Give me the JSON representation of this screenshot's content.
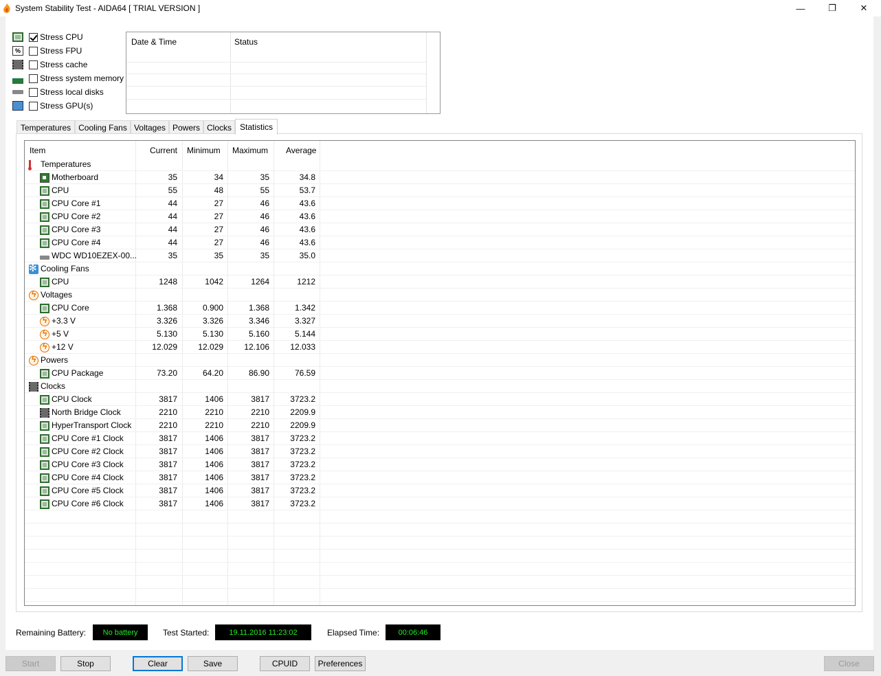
{
  "window": {
    "title": "System Stability Test - AIDA64  [ TRIAL VERSION ]",
    "minimize": "—",
    "maximize": "❐",
    "close": "✕"
  },
  "stress_options": [
    {
      "label": "Stress CPU",
      "checked": true,
      "icon": "cpu-chip-icon"
    },
    {
      "label": "Stress FPU",
      "checked": false,
      "icon": "fpu-icon"
    },
    {
      "label": "Stress cache",
      "checked": false,
      "icon": "cache-icon"
    },
    {
      "label": "Stress system memory",
      "checked": false,
      "icon": "memory-icon"
    },
    {
      "label": "Stress local disks",
      "checked": false,
      "icon": "disk-icon"
    },
    {
      "label": "Stress GPU(s)",
      "checked": false,
      "icon": "gpu-icon"
    }
  ],
  "log": {
    "col_datetime": "Date & Time",
    "col_status": "Status"
  },
  "tabs": [
    {
      "label": "Temperatures",
      "active": false
    },
    {
      "label": "Cooling Fans",
      "active": false
    },
    {
      "label": "Voltages",
      "active": false
    },
    {
      "label": "Powers",
      "active": false
    },
    {
      "label": "Clocks",
      "active": false
    },
    {
      "label": "Statistics",
      "active": true
    }
  ],
  "stats": {
    "headers": {
      "item": "Item",
      "current": "Current",
      "minimum": "Minimum",
      "maximum": "Maximum",
      "average": "Average"
    },
    "rows": [
      {
        "group": true,
        "name": "Temperatures",
        "icon": "thermometer-icon"
      },
      {
        "name": "Motherboard",
        "icon": "motherboard-icon",
        "cur": "35",
        "min": "34",
        "max": "35",
        "avg": "34.8"
      },
      {
        "name": "CPU",
        "icon": "cpu-chip-icon",
        "cur": "55",
        "min": "48",
        "max": "55",
        "avg": "53.7"
      },
      {
        "name": "CPU Core #1",
        "icon": "cpu-chip-icon",
        "cur": "44",
        "min": "27",
        "max": "46",
        "avg": "43.6"
      },
      {
        "name": "CPU Core #2",
        "icon": "cpu-chip-icon",
        "cur": "44",
        "min": "27",
        "max": "46",
        "avg": "43.6"
      },
      {
        "name": "CPU Core #3",
        "icon": "cpu-chip-icon",
        "cur": "44",
        "min": "27",
        "max": "46",
        "avg": "43.6"
      },
      {
        "name": "CPU Core #4",
        "icon": "cpu-chip-icon",
        "cur": "44",
        "min": "27",
        "max": "46",
        "avg": "43.6"
      },
      {
        "name": "WDC WD10EZEX-00...",
        "icon": "disk-icon",
        "cur": "35",
        "min": "35",
        "max": "35",
        "avg": "35.0"
      },
      {
        "group": true,
        "name": "Cooling Fans",
        "icon": "fan-icon"
      },
      {
        "name": "CPU",
        "icon": "cpu-chip-icon",
        "cur": "1248",
        "min": "1042",
        "max": "1264",
        "avg": "1212"
      },
      {
        "group": true,
        "name": "Voltages",
        "icon": "voltage-icon"
      },
      {
        "name": "CPU Core",
        "icon": "cpu-chip-icon",
        "cur": "1.368",
        "min": "0.900",
        "max": "1.368",
        "avg": "1.342"
      },
      {
        "name": "+3.3 V",
        "icon": "voltage-icon",
        "cur": "3.326",
        "min": "3.326",
        "max": "3.346",
        "avg": "3.327"
      },
      {
        "name": "+5 V",
        "icon": "voltage-icon",
        "cur": "5.130",
        "min": "5.130",
        "max": "5.160",
        "avg": "5.144"
      },
      {
        "name": "+12 V",
        "icon": "voltage-icon",
        "cur": "12.029",
        "min": "12.029",
        "max": "12.106",
        "avg": "12.033"
      },
      {
        "group": true,
        "name": "Powers",
        "icon": "voltage-icon"
      },
      {
        "name": "CPU Package",
        "icon": "cpu-chip-icon",
        "cur": "73.20",
        "min": "64.20",
        "max": "86.90",
        "avg": "76.59"
      },
      {
        "group": true,
        "name": "Clocks",
        "icon": "cache-icon"
      },
      {
        "name": "CPU Clock",
        "icon": "cpu-chip-icon",
        "cur": "3817",
        "min": "1406",
        "max": "3817",
        "avg": "3723.2"
      },
      {
        "name": "North Bridge Clock",
        "icon": "cache-icon",
        "cur": "2210",
        "min": "2210",
        "max": "2210",
        "avg": "2209.9"
      },
      {
        "name": "HyperTransport Clock",
        "icon": "cpu-chip-icon",
        "cur": "2210",
        "min": "2210",
        "max": "2210",
        "avg": "2209.9"
      },
      {
        "name": "CPU Core #1 Clock",
        "icon": "cpu-chip-icon",
        "cur": "3817",
        "min": "1406",
        "max": "3817",
        "avg": "3723.2"
      },
      {
        "name": "CPU Core #2 Clock",
        "icon": "cpu-chip-icon",
        "cur": "3817",
        "min": "1406",
        "max": "3817",
        "avg": "3723.2"
      },
      {
        "name": "CPU Core #3 Clock",
        "icon": "cpu-chip-icon",
        "cur": "3817",
        "min": "1406",
        "max": "3817",
        "avg": "3723.2"
      },
      {
        "name": "CPU Core #4 Clock",
        "icon": "cpu-chip-icon",
        "cur": "3817",
        "min": "1406",
        "max": "3817",
        "avg": "3723.2"
      },
      {
        "name": "CPU Core #5 Clock",
        "icon": "cpu-chip-icon",
        "cur": "3817",
        "min": "1406",
        "max": "3817",
        "avg": "3723.2"
      },
      {
        "name": "CPU Core #6 Clock",
        "icon": "cpu-chip-icon",
        "cur": "3817",
        "min": "1406",
        "max": "3817",
        "avg": "3723.2"
      }
    ]
  },
  "status": {
    "battery_label": "Remaining Battery:",
    "battery_value": "No battery",
    "started_label": "Test Started:",
    "started_value": "19.11.2016 11:23:02",
    "elapsed_label": "Elapsed Time:",
    "elapsed_value": "00:06:46"
  },
  "buttons": {
    "start": "Start",
    "stop": "Stop",
    "clear": "Clear",
    "save": "Save",
    "cpuid": "CPUID",
    "preferences": "Preferences",
    "close": "Close"
  },
  "colors": {
    "lcd_text": "#22ee22",
    "lcd_bg": "#000000",
    "focus": "#0078d7"
  }
}
